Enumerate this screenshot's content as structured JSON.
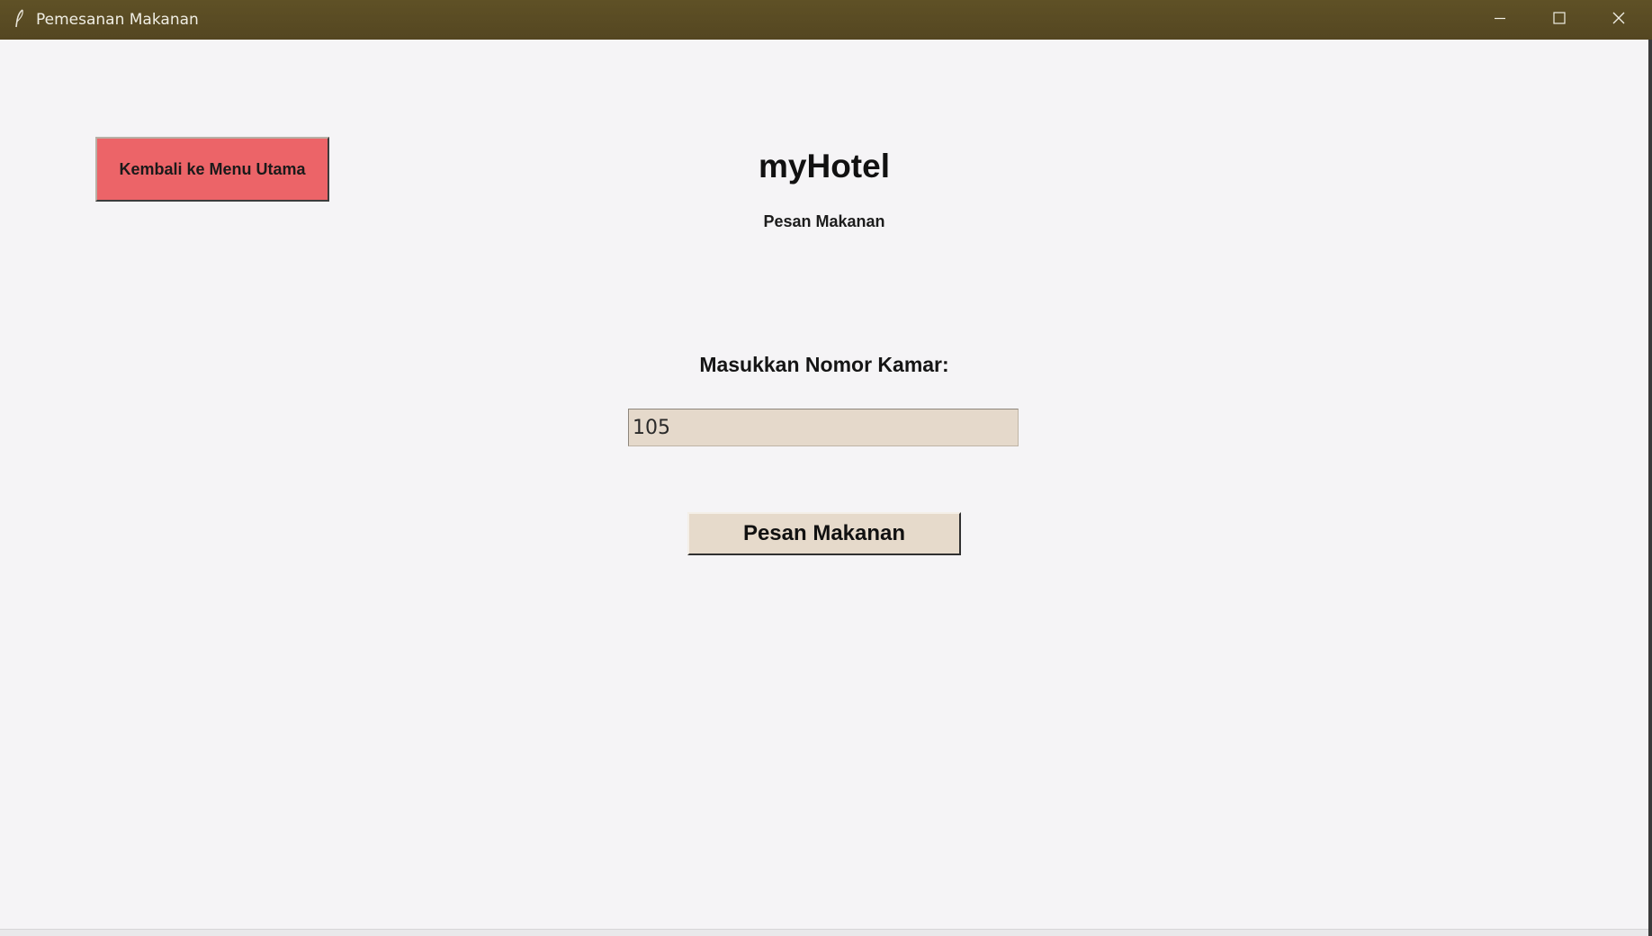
{
  "window": {
    "title": "Pemesanan Makanan",
    "icons": {
      "app": "feather-icon",
      "minimize": "minimize-icon",
      "maximize": "maximize-icon",
      "close": "close-icon"
    }
  },
  "colors": {
    "titlebar": "#5a4b23",
    "back_button": "#ec6468",
    "input_bg": "#e5d9cb",
    "order_button": "#e6dacb",
    "background": "#f5f4f6"
  },
  "header": {
    "back_label": "Kembali ke Menu Utama",
    "app_title": "myHotel",
    "subtitle": "Pesan Makanan"
  },
  "form": {
    "room_label": "Masukkan Nomor Kamar:",
    "room_value": "105",
    "submit_label": "Pesan Makanan"
  }
}
